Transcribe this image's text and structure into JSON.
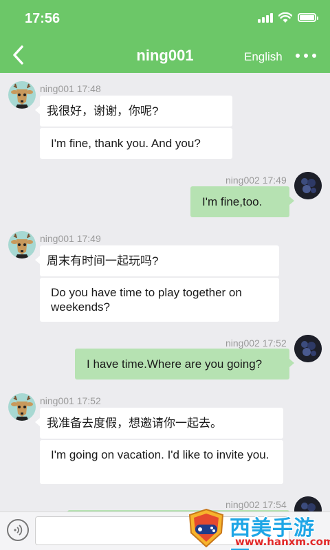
{
  "status_bar": {
    "time": "17:56"
  },
  "header": {
    "title": "ning001",
    "language_label": "English"
  },
  "messages": [
    {
      "sender": "ning001",
      "time": "17:48",
      "meta": "ning001 17:48",
      "original": "我很好，谢谢，你呢?",
      "translation": "I'm fine, thank you. And you?"
    },
    {
      "sender": "ning002",
      "time": "17:49",
      "meta": "ning002 17:49",
      "text": "I'm fine,too."
    },
    {
      "sender": "ning001",
      "time": "17:49",
      "meta": "ning001 17:49",
      "original": "周末有时间一起玩吗?",
      "translation": "Do you have time to play together on weekends?"
    },
    {
      "sender": "ning002",
      "time": "17:52",
      "meta": "ning002 17:52",
      "text": "I have time.Where are you going?"
    },
    {
      "sender": "ning001",
      "time": "17:52",
      "meta": "ning001 17:52",
      "original": "我准备去度假，想邀请你一起去。",
      "translation": "I'm going on vacation. I'd like to invite you."
    },
    {
      "sender": "ning002",
      "time": "17:54",
      "meta": "ning002 17:54",
      "text": ""
    }
  ],
  "input": {
    "value": "",
    "placeholder": ""
  },
  "watermark": {
    "text": "西美手游网",
    "url": "www.hanxm.com"
  },
  "colors": {
    "header": "#6cc768",
    "outgoing_bubble": "#b6e2b2",
    "incoming_bubble": "#ffffff",
    "background": "#ececef"
  }
}
